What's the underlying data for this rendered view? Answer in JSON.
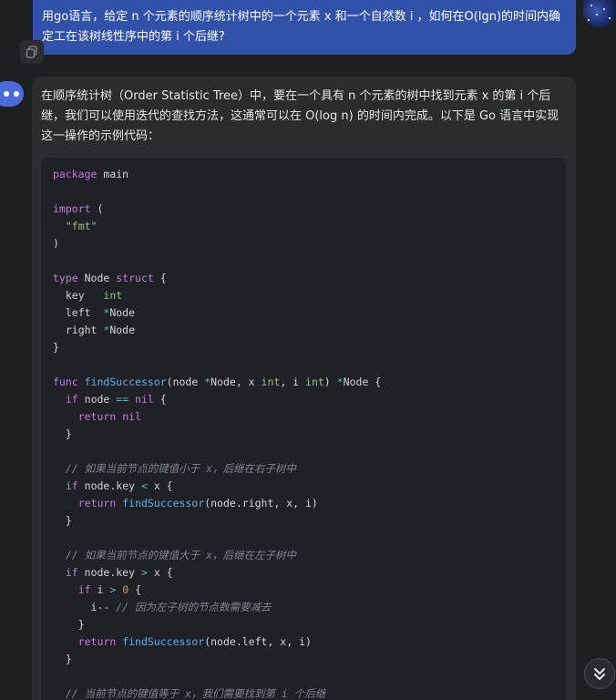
{
  "user_message": {
    "text": "用go语言，给定 n 个元素的顺序统计树中的一个元素 x 和一个自然数 i ，如何在O(lgn)的时间内确定工在该树线性序中的第 i 个后继?"
  },
  "bot_message": {
    "intro": "在顺序统计树（Order Statistic Tree）中，要在一个具有 n 个元素的树中找到元素 x 的第 i 个后继，我们可以使用迭代的查找方法，这通常可以在 O(log n) 的时间内完成。以下是 Go 语言中实现这一操作的示例代码："
  },
  "code_lines": [
    [
      {
        "t": "package",
        "c": "kw"
      },
      {
        "t": " main",
        "c": "plain"
      }
    ],
    [],
    [
      {
        "t": "import",
        "c": "kw"
      },
      {
        "t": " (",
        "c": "plain"
      }
    ],
    [
      {
        "t": "  \"fmt\"",
        "c": "str"
      }
    ],
    [
      {
        "t": ")",
        "c": "plain"
      }
    ],
    [],
    [
      {
        "t": "type",
        "c": "kw"
      },
      {
        "t": " Node ",
        "c": "plain"
      },
      {
        "t": "struct",
        "c": "kw"
      },
      {
        "t": " {",
        "c": "plain"
      }
    ],
    [
      {
        "t": "  key   ",
        "c": "plain"
      },
      {
        "t": "int",
        "c": "ty"
      }
    ],
    [
      {
        "t": "  left  ",
        "c": "plain"
      },
      {
        "t": "*",
        "c": "op"
      },
      {
        "t": "Node",
        "c": "plain"
      }
    ],
    [
      {
        "t": "  right ",
        "c": "plain"
      },
      {
        "t": "*",
        "c": "op"
      },
      {
        "t": "Node",
        "c": "plain"
      }
    ],
    [
      {
        "t": "}",
        "c": "plain"
      }
    ],
    [],
    [
      {
        "t": "func",
        "c": "kw"
      },
      {
        "t": " ",
        "c": "plain"
      },
      {
        "t": "findSuccessor",
        "c": "fn"
      },
      {
        "t": "(node ",
        "c": "plain"
      },
      {
        "t": "*",
        "c": "op"
      },
      {
        "t": "Node, x ",
        "c": "plain"
      },
      {
        "t": "int",
        "c": "ty"
      },
      {
        "t": ", i ",
        "c": "plain"
      },
      {
        "t": "int",
        "c": "ty"
      },
      {
        "t": ") ",
        "c": "plain"
      },
      {
        "t": "*",
        "c": "op"
      },
      {
        "t": "Node {",
        "c": "plain"
      }
    ],
    [
      {
        "t": "  ",
        "c": "plain"
      },
      {
        "t": "if",
        "c": "kw"
      },
      {
        "t": " node ",
        "c": "plain"
      },
      {
        "t": "==",
        "c": "op"
      },
      {
        "t": " ",
        "c": "plain"
      },
      {
        "t": "nil",
        "c": "kw"
      },
      {
        "t": " {",
        "c": "plain"
      }
    ],
    [
      {
        "t": "    ",
        "c": "plain"
      },
      {
        "t": "return",
        "c": "kw"
      },
      {
        "t": " ",
        "c": "plain"
      },
      {
        "t": "nil",
        "c": "kw"
      }
    ],
    [
      {
        "t": "  }",
        "c": "plain"
      }
    ],
    [],
    [
      {
        "t": "  // 如果当前节点的键值小于 x，后继在右子树中",
        "c": "cm"
      }
    ],
    [
      {
        "t": "  ",
        "c": "plain"
      },
      {
        "t": "if",
        "c": "kw"
      },
      {
        "t": " node.key ",
        "c": "plain"
      },
      {
        "t": "<",
        "c": "op"
      },
      {
        "t": " x {",
        "c": "plain"
      }
    ],
    [
      {
        "t": "    ",
        "c": "plain"
      },
      {
        "t": "return",
        "c": "kw"
      },
      {
        "t": " ",
        "c": "plain"
      },
      {
        "t": "findSuccessor",
        "c": "fn"
      },
      {
        "t": "(node.right, x, i)",
        "c": "plain"
      }
    ],
    [
      {
        "t": "  }",
        "c": "plain"
      }
    ],
    [],
    [
      {
        "t": "  // 如果当前节点的键值大于 x，后继在左子树中",
        "c": "cm"
      }
    ],
    [
      {
        "t": "  ",
        "c": "plain"
      },
      {
        "t": "if",
        "c": "kw"
      },
      {
        "t": " node.key ",
        "c": "plain"
      },
      {
        "t": ">",
        "c": "op"
      },
      {
        "t": " x {",
        "c": "plain"
      }
    ],
    [
      {
        "t": "    ",
        "c": "plain"
      },
      {
        "t": "if",
        "c": "kw"
      },
      {
        "t": " i ",
        "c": "plain"
      },
      {
        "t": ">",
        "c": "op"
      },
      {
        "t": " ",
        "c": "plain"
      },
      {
        "t": "0",
        "c": "num"
      },
      {
        "t": " {",
        "c": "plain"
      }
    ],
    [
      {
        "t": "      i-- ",
        "c": "plain"
      },
      {
        "t": "// 因为左子树的节点数需要减去",
        "c": "cm"
      }
    ],
    [
      {
        "t": "    }",
        "c": "plain"
      }
    ],
    [
      {
        "t": "    ",
        "c": "plain"
      },
      {
        "t": "return",
        "c": "kw"
      },
      {
        "t": " ",
        "c": "plain"
      },
      {
        "t": "findSuccessor",
        "c": "fn"
      },
      {
        "t": "(node.left, x, i)",
        "c": "plain"
      }
    ],
    [
      {
        "t": "  }",
        "c": "plain"
      }
    ],
    [],
    [
      {
        "t": "  // 当前节点的键值等于 x，我们需要找到第 i 个后继",
        "c": "cm"
      }
    ]
  ],
  "icons": {
    "copy": "copy-icon",
    "scroll_down": "chevron-double-down-icon",
    "bot_avatar": "bot-avatar-icon",
    "user_avatar": "user-avatar-image"
  },
  "colors": {
    "user_bubble": "#3251a8",
    "bot_bubble": "#2b2c30",
    "code_bg": "#1f2126",
    "accent": "#4d6bd8"
  }
}
